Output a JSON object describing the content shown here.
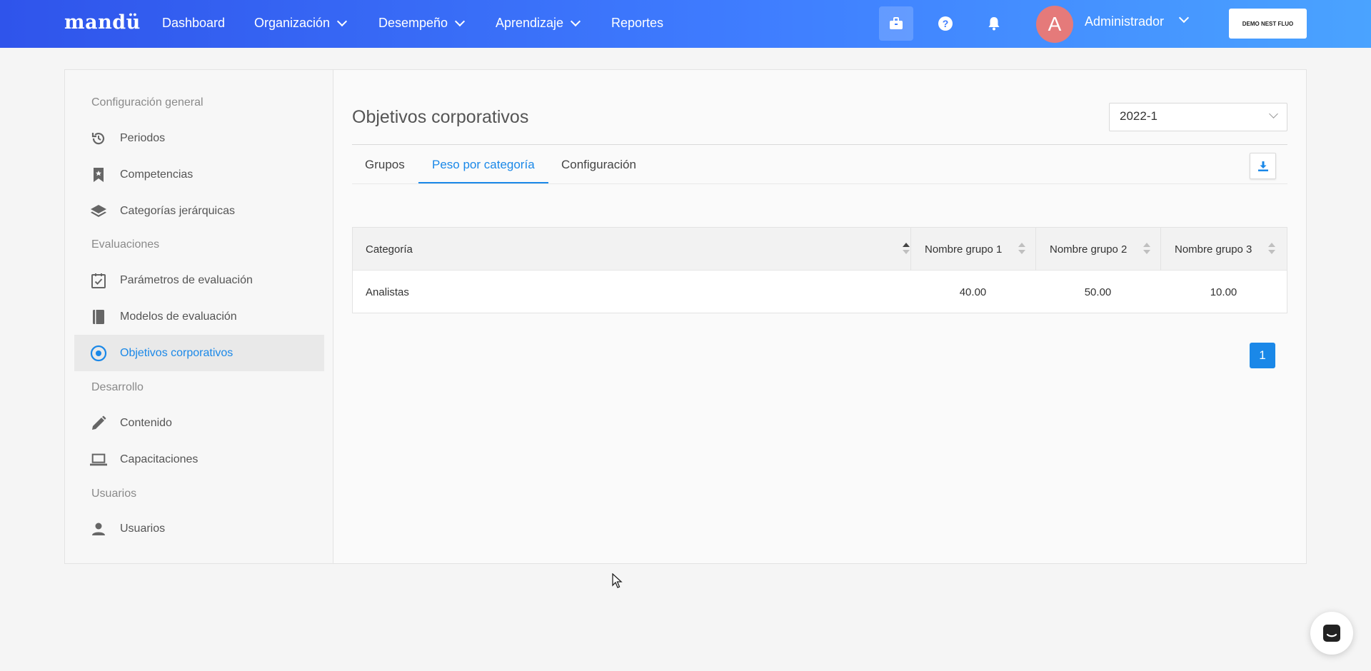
{
  "nav": {
    "brand": "mandü",
    "items": [
      {
        "label": "Dashboard"
      },
      {
        "label": "Organización"
      },
      {
        "label": "Desempeño"
      },
      {
        "label": "Aprendizaje"
      },
      {
        "label": "Reportes"
      }
    ],
    "avatar_letter": "A",
    "user_name": "Administrador",
    "demo_label": "DEMO NEST FLUO",
    "icons": [
      "briefcase-icon",
      "help-icon",
      "bell-icon"
    ]
  },
  "sidebar": {
    "sections": [
      {
        "label": "Configuración general"
      },
      {
        "label": "Evaluaciones"
      },
      {
        "label": "Desarrollo"
      },
      {
        "label": "Usuarios"
      }
    ],
    "items": [
      {
        "label": "Periodos",
        "icon": "history-icon"
      },
      {
        "label": "Competencias",
        "icon": "bookmark-icon"
      },
      {
        "label": "Categorías jerárquicas",
        "icon": "layers-icon"
      },
      {
        "label": "Parámetros de evaluación",
        "icon": "calendar-check-icon"
      },
      {
        "label": "Modelos de evaluación",
        "icon": "book-icon"
      },
      {
        "label": "Objetivos corporativos",
        "icon": "target-icon",
        "active": true
      },
      {
        "label": "Contenido",
        "icon": "pencil-icon"
      },
      {
        "label": "Capacitaciones",
        "icon": "laptop-icon"
      },
      {
        "label": "Usuarios",
        "icon": "user-icon"
      }
    ]
  },
  "main": {
    "title": "Objetivos corporativos",
    "period": "2022-1",
    "tabs": [
      {
        "label": "Grupos"
      },
      {
        "label": "Peso por categoría",
        "active": true
      },
      {
        "label": "Configuración"
      }
    ],
    "table": {
      "headers": [
        "Categoría",
        "Nombre grupo 1",
        "Nombre grupo 2",
        "Nombre grupo 3"
      ],
      "rows": [
        {
          "category": "Analistas",
          "g1": "40.00",
          "g2": "50.00",
          "g3": "10.00"
        }
      ]
    },
    "pagination": {
      "current": "1"
    }
  },
  "colors": {
    "accent": "#1a88e8",
    "nav_gradient_start": "#2f54eb",
    "nav_gradient_end": "#4aa3ff",
    "avatar": "#e57a7a"
  }
}
